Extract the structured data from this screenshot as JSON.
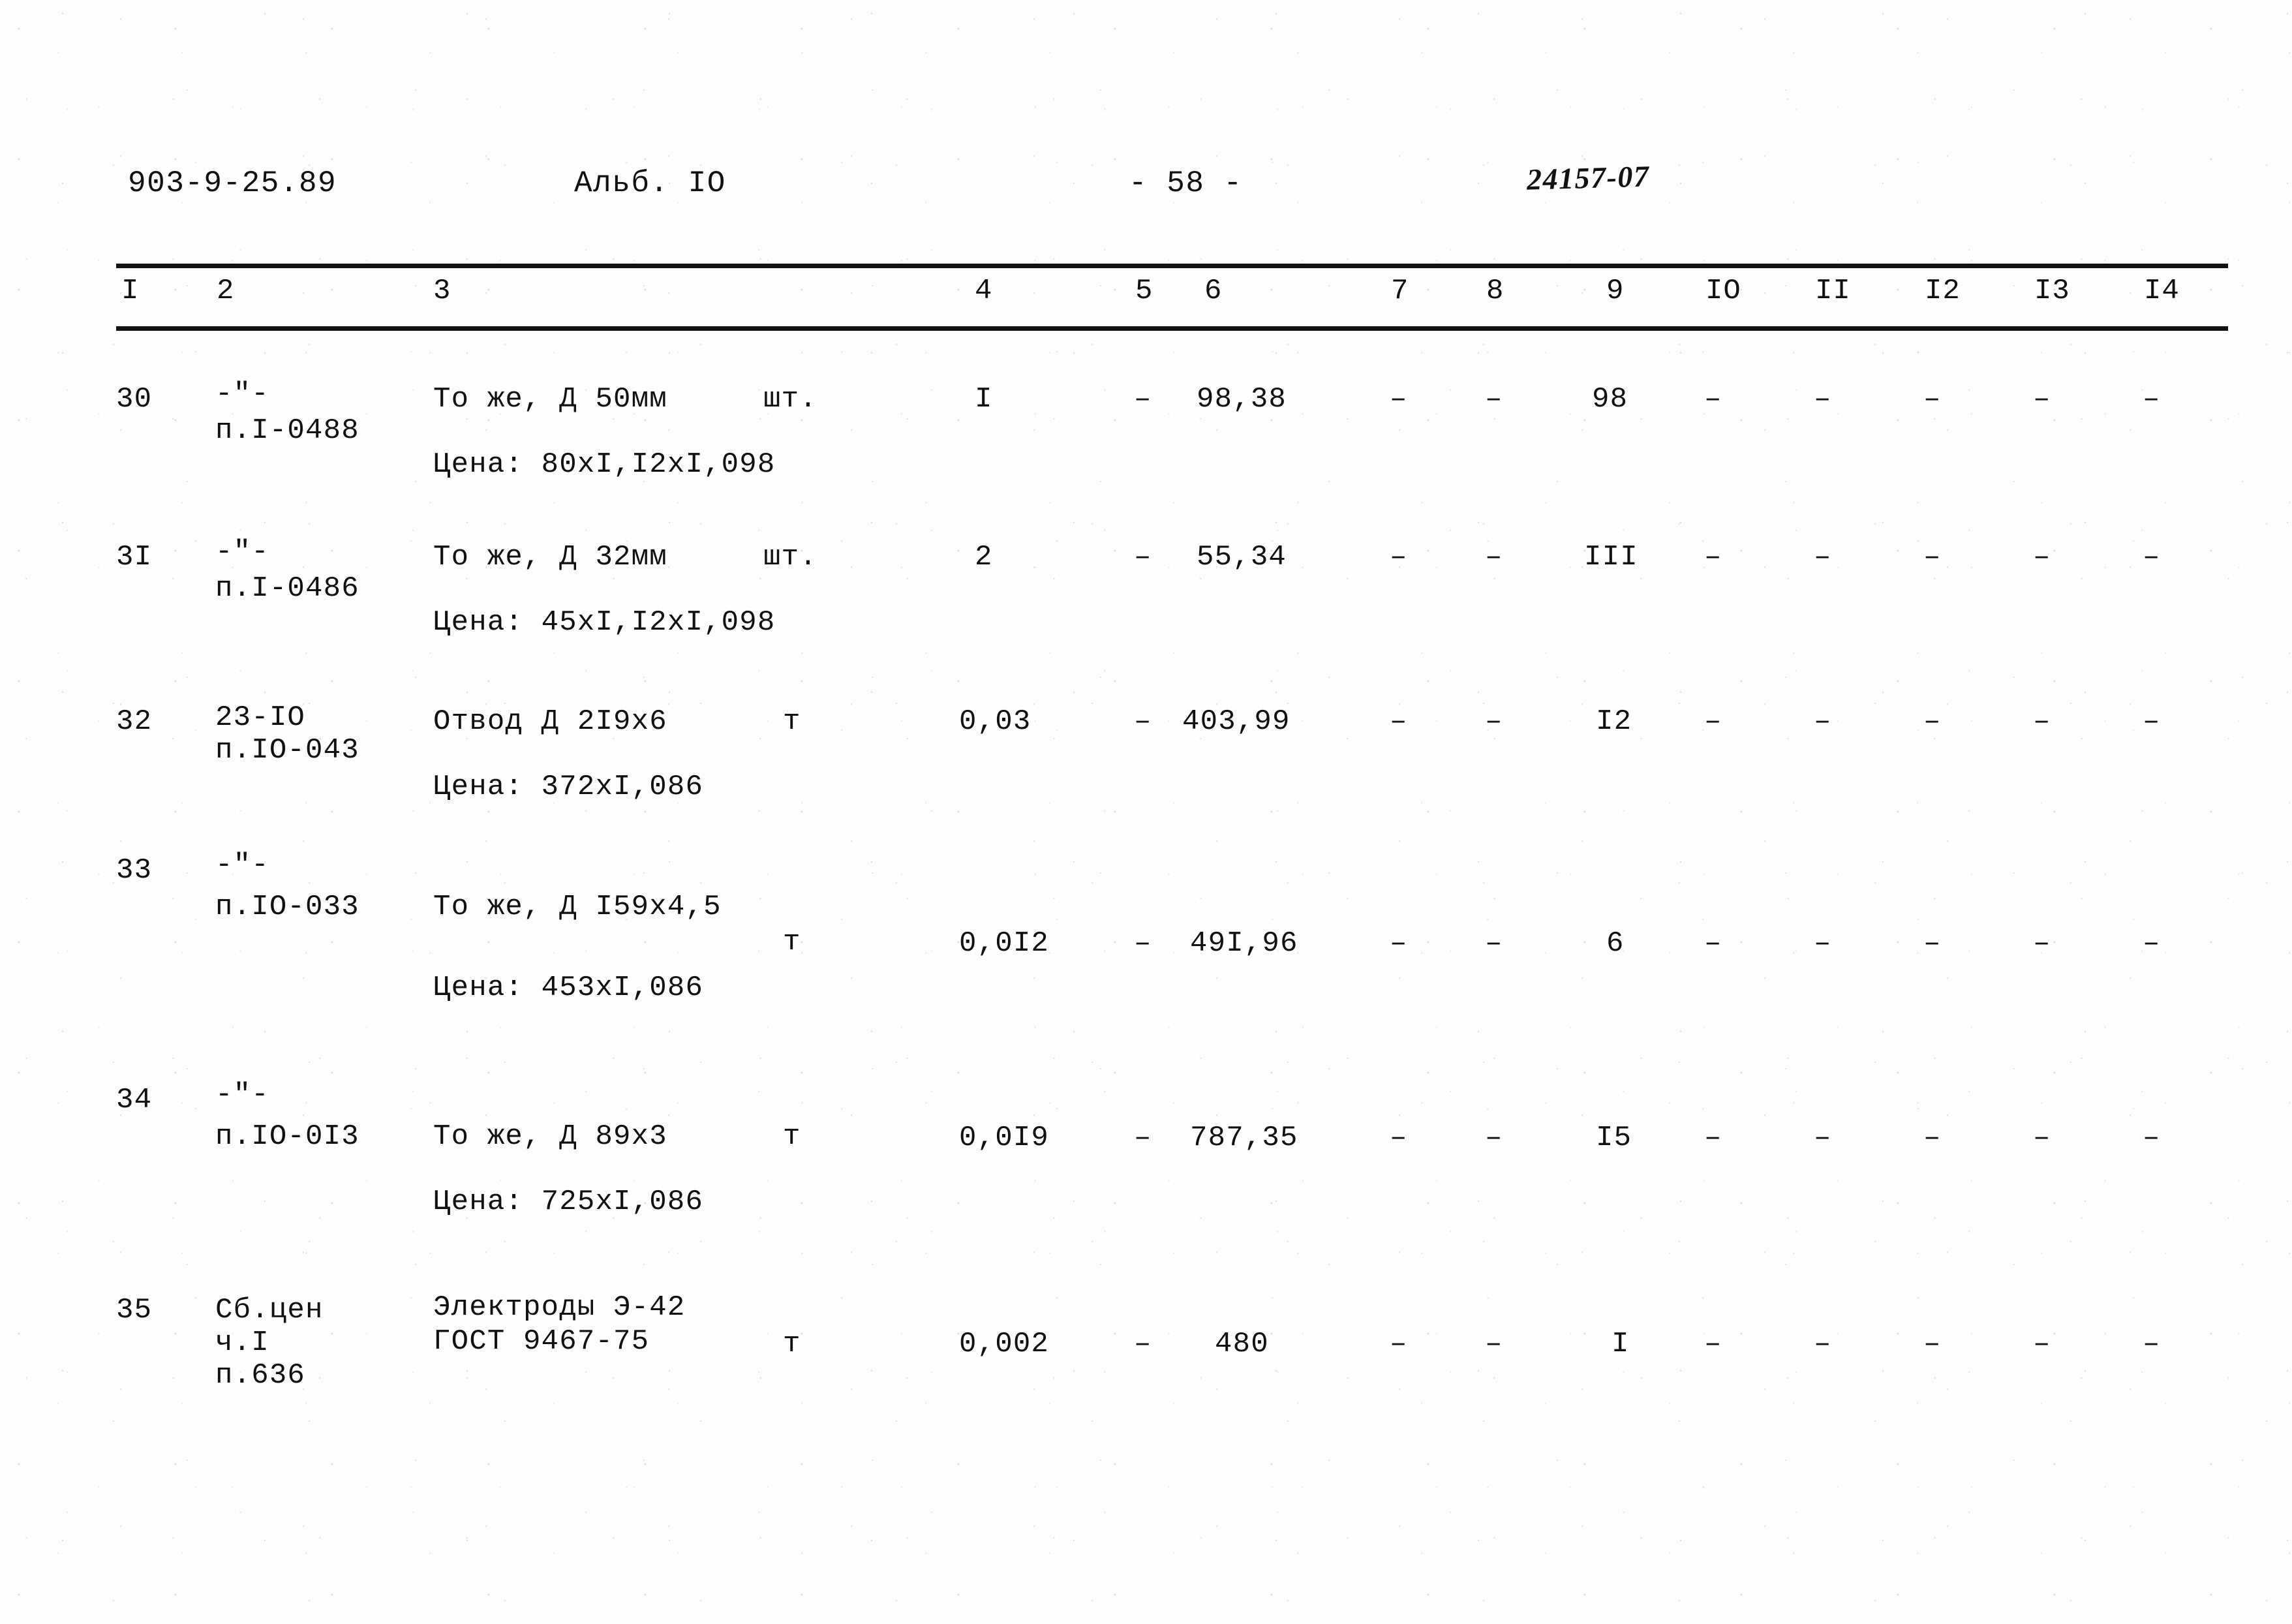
{
  "header": {
    "series_code": "903-9-25.89",
    "album": "Альб. IO",
    "page_marker": "- 58 -",
    "archive_stamp": "24157-07"
  },
  "table": {
    "column_headers": [
      "I",
      "2",
      "3",
      "4",
      "5",
      "6",
      "7",
      "8",
      "9",
      "IO",
      "II",
      "I2",
      "I3",
      "I4"
    ],
    "rows": [
      {
        "no": "30",
        "code_lines": [
          "-\"-",
          "п.I-0488"
        ],
        "description_lines": [
          "То же, Д 50мм"
        ],
        "price_line": "Цена: 80xI,I2xI,098",
        "unit": "шт.",
        "col4": "I",
        "col5": "–",
        "col6": "98,38",
        "col7": "–",
        "col8": "–",
        "col9": "98",
        "col10": "–",
        "col11": "–",
        "col12": "–",
        "col13": "–",
        "col14": "–"
      },
      {
        "no": "3I",
        "code_lines": [
          "-\"-",
          "п.I-0486"
        ],
        "description_lines": [
          "То же, Д 32мм"
        ],
        "price_line": "Цена: 45xI,I2xI,098",
        "unit": "шт.",
        "col4": "2",
        "col5": "–",
        "col6": "55,34",
        "col7": "–",
        "col8": "–",
        "col9": "III",
        "col10": "–",
        "col11": "–",
        "col12": "–",
        "col13": "–",
        "col14": "–"
      },
      {
        "no": "32",
        "code_lines": [
          "23-IO",
          "п.IO-043"
        ],
        "description_lines": [
          "Отвод Д 2I9x6"
        ],
        "price_line": "Цена: 372xI,086",
        "unit": "т",
        "col4": "0,03",
        "col5": "–",
        "col6": "403,99",
        "col7": "–",
        "col8": "–",
        "col9": "I2",
        "col10": "–",
        "col11": "–",
        "col12": "–",
        "col13": "–",
        "col14": "–"
      },
      {
        "no": "33",
        "code_lines": [
          "-\"-",
          "п.IO-033"
        ],
        "description_lines": [
          "То же, Д I59x4,5"
        ],
        "price_line": "Цена: 453xI,086",
        "unit": "т",
        "col4": "0,0I2",
        "col5": "–",
        "col6": "49I,96",
        "col7": "–",
        "col8": "–",
        "col9": "6",
        "col10": "–",
        "col11": "–",
        "col12": "–",
        "col13": "–",
        "col14": "–"
      },
      {
        "no": "34",
        "code_lines": [
          "-\"-",
          "п.IO-0I3"
        ],
        "description_lines": [
          "То же, Д 89x3"
        ],
        "price_line": "Цена: 725xI,086",
        "unit": "т",
        "col4": "0,0I9",
        "col5": "–",
        "col6": "787,35",
        "col7": "–",
        "col8": "–",
        "col9": "I5",
        "col10": "–",
        "col11": "–",
        "col12": "–",
        "col13": "–",
        "col14": "–"
      },
      {
        "no": "35",
        "code_lines": [
          "Сб.цен",
          "ч.I",
          "п.636"
        ],
        "description_lines": [
          "Электроды Э-42",
          "ГОСТ 9467-75"
        ],
        "price_line": "",
        "unit": "т",
        "col4": "0,002",
        "col5": "–",
        "col6": "480",
        "col7": "–",
        "col8": "–",
        "col9": "I",
        "col10": "–",
        "col11": "–",
        "col12": "–",
        "col13": "–",
        "col14": "–"
      }
    ]
  }
}
